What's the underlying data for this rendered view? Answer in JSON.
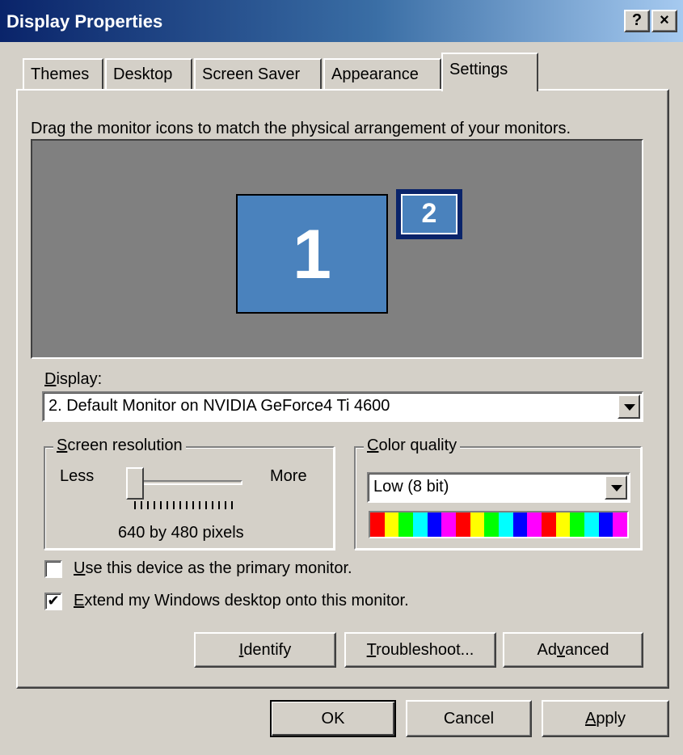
{
  "window": {
    "title": "Display Properties",
    "help_label": "?",
    "close_label": "×"
  },
  "tabs": [
    {
      "label": "Themes",
      "active": false
    },
    {
      "label": "Desktop",
      "active": false
    },
    {
      "label": "Screen Saver",
      "active": false
    },
    {
      "label": "Appearance",
      "active": false
    },
    {
      "label": "Settings",
      "active": true
    }
  ],
  "settings": {
    "instruction": "Drag the monitor icons to match the physical arrangement of your monitors.",
    "monitors": [
      {
        "number": "1"
      },
      {
        "number": "2",
        "selected": true
      }
    ],
    "display": {
      "label_u": "D",
      "label_rest": "isplay:",
      "selected": "2. Default Monitor on NVIDIA GeForce4 Ti 4600"
    },
    "screen_resolution": {
      "label_u": "S",
      "label_rest": "creen resolution",
      "less_label": "Less",
      "more_label": "More",
      "value_text": "640 by 480 pixels",
      "slider_position": 0
    },
    "color_quality": {
      "label_u": "C",
      "label_rest": "olor quality",
      "selected": "Low (8 bit)",
      "spectrum_colors": [
        "#ff0000",
        "#ffff00",
        "#00ff00",
        "#00ffff",
        "#0000ff",
        "#ff00ff",
        "#ff0000",
        "#ffff00",
        "#00ff00",
        "#00ffff",
        "#0000ff",
        "#ff00ff",
        "#ff0000",
        "#ffff00",
        "#00ff00",
        "#00ffff",
        "#0000ff",
        "#ff00ff"
      ]
    },
    "primary_checkbox": {
      "checked": false,
      "label_u": "U",
      "label_rest": "se this device as the primary monitor."
    },
    "extend_checkbox": {
      "checked": true,
      "label_u": "E",
      "label_rest": "xtend my Windows desktop onto this monitor."
    },
    "buttons": {
      "identify_u": "I",
      "identify_rest": "dentify",
      "troubleshoot_u": "T",
      "troubleshoot_rest": "roubleshoot...",
      "advanced_pre": "Ad",
      "advanced_u": "v",
      "advanced_rest": "anced"
    }
  },
  "footer": {
    "ok": "OK",
    "cancel": "Cancel",
    "apply_u": "A",
    "apply_rest": "pply"
  },
  "colors": {
    "face": "#d4d0c8",
    "title_start": "#0a246a",
    "title_end": "#a6caf0",
    "monitor_fill": "#4a82bd",
    "preview_bg": "#808080"
  },
  "icons": {
    "dropdown": "chevron-down-icon",
    "help": "help-icon",
    "close": "close-icon",
    "check": "checkmark-icon"
  }
}
